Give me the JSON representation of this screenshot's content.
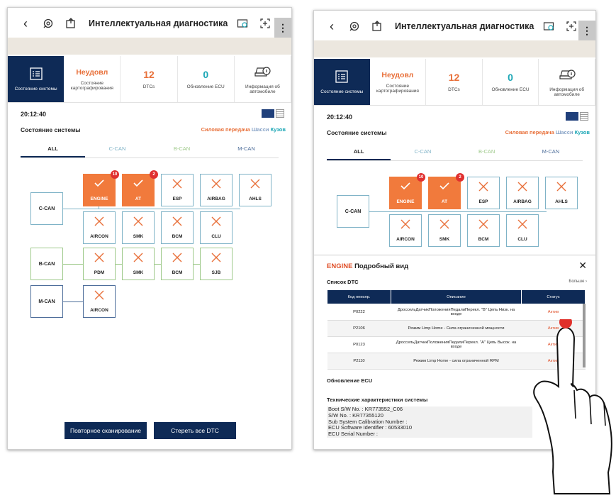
{
  "app": {
    "title": "Интеллектуальная диагностика",
    "menu_glyph": "⋮"
  },
  "tiles": {
    "system_status": "Состояние системы",
    "mapping_value": "Неудовл",
    "mapping_label": "Состояние картографирования",
    "dtc_value": "12",
    "dtc_label": "DTCs",
    "ecu_value": "0",
    "ecu_label": "Обновление ECU",
    "vehicle_info": "Информация об автомобиле"
  },
  "time": "20:12:40",
  "section": {
    "title": "Состояние системы",
    "cat_powertrain": "Силовая передача",
    "cat_chassis": "Шасси",
    "cat_body": "Кузов"
  },
  "tabs": [
    "ALL",
    "C-CAN",
    "B-CAN",
    "M-CAN"
  ],
  "network": {
    "buses": [
      "C-CAN",
      "B-CAN",
      "M-CAN"
    ],
    "ccan_row1": [
      {
        "name": "ENGINE",
        "ok": true,
        "badge": "10"
      },
      {
        "name": "AT",
        "ok": true,
        "badge": "2"
      },
      {
        "name": "ESP",
        "ok": false
      },
      {
        "name": "AIRBAG",
        "ok": false
      },
      {
        "name": "AHLS",
        "ok": false
      }
    ],
    "ccan_row2": [
      "AIRCON",
      "SMK",
      "BCM",
      "CLU"
    ],
    "bcan_row": [
      "PDM",
      "SMK",
      "BCM",
      "SJB"
    ],
    "mcan_row": [
      "AIRCON"
    ]
  },
  "buttons": {
    "rescan": "Повторное сканирование",
    "clear_dtc": "Стереть все DTC"
  },
  "detail": {
    "module": "ENGINE",
    "view_title": "Подробный вид",
    "close": "✕",
    "dtc_list_title": "Список DTC",
    "more": "Больше ›",
    "columns": [
      "Код неиспр.",
      "Описание",
      "Статус"
    ],
    "rows": [
      {
        "code": "P0222",
        "desc": "ДроссельДатчикПоложенияПедалиПерекл. \"B\" Цепь Низк. на входе",
        "status": "Актив"
      },
      {
        "code": "P2106",
        "desc": "Режим Limp Home - Сила ограниченной мощности",
        "status": "Актив"
      },
      {
        "code": "P0123",
        "desc": "ДроссельДатчикПоложенияПедалиПерекл. \"A\" Цепь Высок. на входе",
        "status": "Актив"
      },
      {
        "code": "P2110",
        "desc": "Режим Limp Home - сила ограниченной RPM",
        "status": "Актив"
      }
    ],
    "ecu_update_title": "Обновление ECU",
    "spec_title": "Технические характеристики системы",
    "spec_lines": [
      "Boot S/W No. : KR773552_C06",
      "S/W No. : KR77355120",
      "Sub System Calibration Number :",
      "ECU Software Identifier : 60533010",
      "ECU Serial Number :"
    ]
  }
}
